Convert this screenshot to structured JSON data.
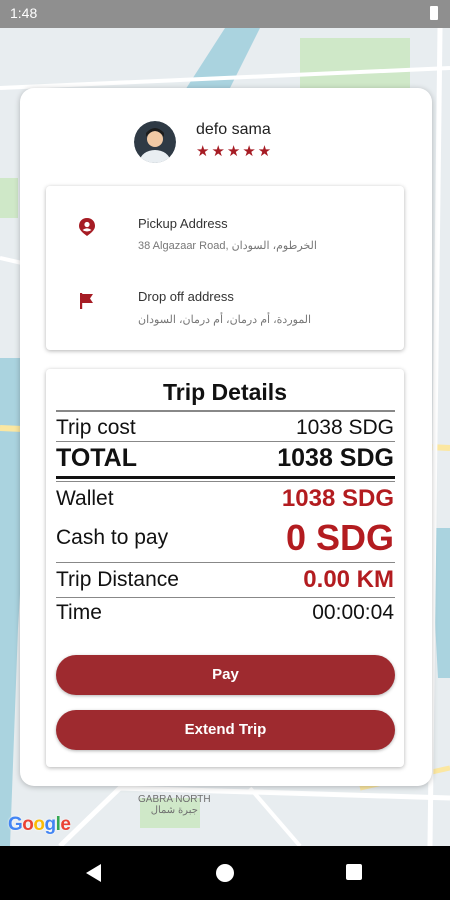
{
  "status_bar": {
    "time": "1:48"
  },
  "map": {
    "attribution": "Google",
    "labels": [
      "GABRA NORTH",
      "جبرة شمال"
    ]
  },
  "driver": {
    "name": "defo sama",
    "rating_stars": "★★★★★",
    "rating": 5
  },
  "pickup": {
    "title": "Pickup Address",
    "value": "38 Algazaar Road, الخرطوم، السودان"
  },
  "dropoff": {
    "title": "Drop off address",
    "value": "الموردة، أم درمان، أم درمان، السودان"
  },
  "trip": {
    "title": "Trip Details",
    "cost_label": "Trip cost",
    "cost_value": "1038 SDG",
    "total_label": "TOTAL",
    "total_value": "1038 SDG",
    "wallet_label": "Wallet",
    "wallet_value": "1038 SDG",
    "cash_label": "Cash to pay",
    "cash_value": "0 SDG",
    "distance_label": "Trip Distance",
    "distance_value": "0.00 KM",
    "time_label": "Time",
    "time_value": "00:00:04"
  },
  "buttons": {
    "pay": "Pay",
    "extend": "Extend Trip"
  },
  "colors": {
    "accent": "#a61c24",
    "button": "#9e2a2f"
  }
}
